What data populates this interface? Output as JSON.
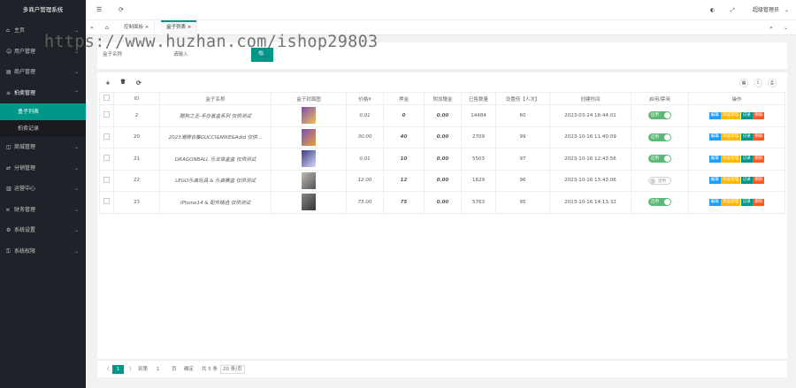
{
  "app": {
    "title": "多商户管理系统"
  },
  "sidebar": {
    "items": [
      {
        "label": "主页",
        "icon": "home-icon",
        "arrow": "⌄"
      },
      {
        "label": "用户管理",
        "icon": "user-icon",
        "arrow": "⌄"
      },
      {
        "label": "商户管理",
        "icon": "shop-icon",
        "arrow": "⌄"
      },
      {
        "label": "拍卖管理",
        "icon": "list-icon",
        "arrow": "⌃"
      },
      {
        "label": "商城管理",
        "icon": "cart-icon",
        "arrow": "⌄"
      },
      {
        "label": "分销管理",
        "icon": "share-icon",
        "arrow": "⌄"
      },
      {
        "label": "运营中心",
        "icon": "chart-icon",
        "arrow": "⌄"
      },
      {
        "label": "财务管理",
        "icon": "money-icon",
        "arrow": "⌄"
      },
      {
        "label": "系统设置",
        "icon": "gear-icon",
        "arrow": "⌄"
      },
      {
        "label": "系统权限",
        "icon": "lock-icon",
        "arrow": "⌄"
      }
    ],
    "sub_items": [
      {
        "label": "盒子列表",
        "active": true
      },
      {
        "label": "拍卖记录",
        "active": false
      }
    ]
  },
  "topbar": {
    "menu_icon": "☰",
    "refresh_icon": "⟳",
    "home_icon": "⌂",
    "account": "超级管理员"
  },
  "tabs": [
    {
      "label": "控制面板"
    },
    {
      "label": "盒子列表"
    }
  ],
  "watermark": "https://www.huzhan.com/ishop29803",
  "filter": {
    "label": "盒子名称",
    "placeholder": "请输入",
    "button": "🔍"
  },
  "toolbar": {
    "add": "+",
    "delete": "🗑",
    "refresh": "⟳"
  },
  "table": {
    "columns": [
      "ID",
      "盒子名称",
      "盒子封面图",
      "价格¥",
      "押金",
      "附加赠金",
      "已售数量",
      "设置倍【人次】",
      "创建时间",
      "启用/禁用",
      "操作"
    ],
    "rows": [
      {
        "id": "2",
        "name": "酷狗之王-手办盲盒系列 仅供测试",
        "price": "0.01",
        "a": "0",
        "b": "0.00",
        "sold": "14484",
        "limit": "60",
        "time": "2023-03-24 16:44:01",
        "status": "启用",
        "on": true
      },
      {
        "id": "20",
        "name": "2023潮牌合集GUCCI&NIKE&Adid 仅供…",
        "price": "30.00",
        "a": "40",
        "b": "0.00",
        "sold": "2709",
        "limit": "99",
        "time": "2023-10-16 11:40:09",
        "status": "启用",
        "on": true
      },
      {
        "id": "21",
        "name": "DRAGONBALL 乐龙珠盒盒 仅供测试",
        "price": "0.01",
        "a": "10",
        "b": "0.00",
        "sold": "5503",
        "limit": "97",
        "time": "2023-10-16 12:43:56",
        "status": "启用",
        "on": true
      },
      {
        "id": "22",
        "name": "LEGO乐高玩具 & 乐高赛盒 仅供测试",
        "price": "12.00",
        "a": "12",
        "b": "0.00",
        "sold": "1829",
        "limit": "96",
        "time": "2023-10-16 13:43:06",
        "status": "禁用",
        "on": false
      },
      {
        "id": "23",
        "name": "iPhone14 & 配件精选 仅供测试",
        "price": "75.00",
        "a": "75",
        "b": "0.00",
        "sold": "5763",
        "limit": "95",
        "time": "2023-10-16 14:13:32",
        "status": "启用",
        "on": true
      }
    ],
    "ops": [
      "编辑",
      "商品管理",
      "记录",
      "删除"
    ]
  },
  "pager": {
    "prev": "〈",
    "page": "1",
    "next": "〉",
    "goto": "到第",
    "input": "1",
    "unit": "页",
    "confirm": "确定",
    "total": "共 5 条",
    "size": "20 条/页"
  },
  "colors": {
    "accent": "#009688",
    "sidebar": "#20222a",
    "blue": "#1e9fff",
    "yellow": "#ffb800",
    "red": "#ff5722"
  }
}
